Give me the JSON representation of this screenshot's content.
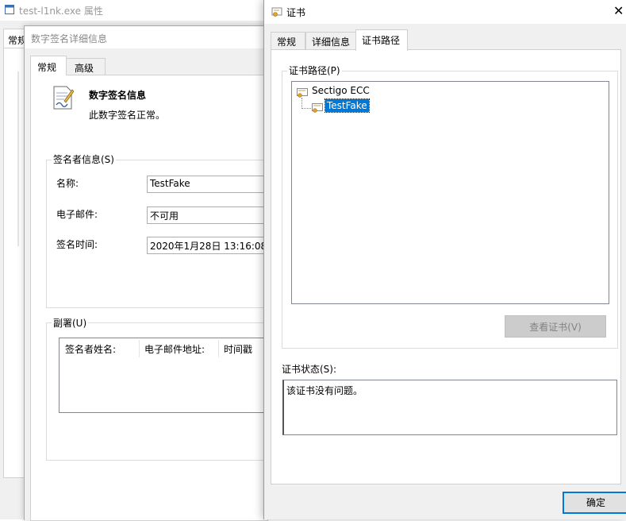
{
  "properties_window": {
    "title": "test-l1nk.exe 属性",
    "tab_general": "常规"
  },
  "signature_window": {
    "title": "数字签名详细信息",
    "tabs": [
      "常规",
      "高级"
    ],
    "info_title": "数字签名信息",
    "info_desc": "此数字签名正常。",
    "signer_group": "签名者信息(S)",
    "name_label": "名称:",
    "name_value": "TestFake",
    "email_label": "电子邮件:",
    "email_value": "不可用",
    "time_label": "签名时间:",
    "time_value": "2020年1月28日 13:16:08",
    "countersign_group": "副署(U)",
    "columns": [
      "签名者姓名:",
      "电子邮件地址:",
      "时间戳"
    ]
  },
  "cert_window": {
    "title": "证书",
    "close_glyph": "✕",
    "tabs": [
      "常规",
      "详细信息",
      "证书路径"
    ],
    "path_group": "证书路径(P)",
    "tree_root": "Sectigo ECC",
    "tree_child": "TestFake",
    "view_cert_button": "查看证书(V)",
    "status_label": "证书状态(S):",
    "status_text": "该证书没有问题。",
    "ok_button": "确定"
  },
  "colors": {
    "selection": "#0078d7",
    "button_disabled": "#cccccc"
  }
}
